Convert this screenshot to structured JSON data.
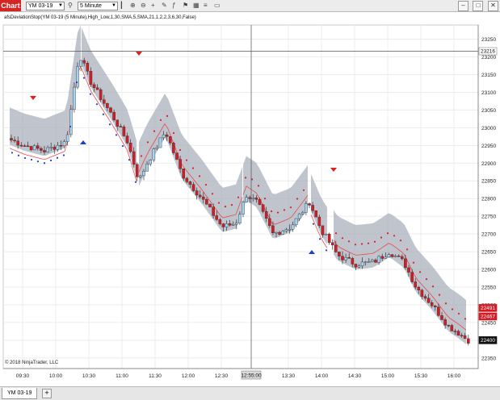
{
  "toolbar": {
    "tab_label": "Chart",
    "instrument": "YM 03-19",
    "interval": "5 Minute",
    "icons": [
      "search-icon",
      "bar-style-icon",
      "zoom-in-icon",
      "zoom-out-icon",
      "crosshair-icon",
      "draw-icon",
      "indicators-icon",
      "strategies-icon",
      "data-box-icon",
      "properties-icon",
      "template-icon"
    ],
    "window_buttons": [
      "minimize-icon",
      "maximize-icon",
      "close-icon"
    ]
  },
  "indicator_label": "afsDeviationStop(YM 03-19 (5 Minute),High_Low,1,30,SMA,5,SMA,21,1,2,2,3,6,30,False)",
  "copyright": "© 2018 NinjaTrader, LLC",
  "bottom_tab": "YM 03-19",
  "add_tab_label": "+",
  "colors": {
    "up_candle": "#a6d3f0",
    "down_candle": "#d51b23",
    "band": "#a9b0bc",
    "stop_line": "#e74c4c",
    "dot_red": "#e11d1d",
    "dot_blue": "#1a3fd1",
    "arrow_red": "#e11d1d",
    "arrow_blue": "#1a3fd1"
  },
  "chart_data": {
    "type": "candlestick",
    "y_range": [
      22320,
      23290
    ],
    "y_ticks": [
      22350,
      22400,
      22450,
      22500,
      22550,
      22600,
      22650,
      22700,
      22750,
      22800,
      22850,
      22900,
      22950,
      23000,
      23050,
      23100,
      23150,
      23200,
      23250
    ],
    "x_ticks": [
      "09:30",
      "10:00",
      "10:30",
      "11:00",
      "11:30",
      "12:00",
      "12:30",
      "12:55:00",
      "13:30",
      "14:00",
      "14:30",
      "15:00",
      "15:30",
      "16:00"
    ],
    "price_labels": [
      {
        "value": "23216",
        "style": "plain"
      },
      {
        "value": "22491",
        "style": "red"
      },
      {
        "value": "22467",
        "style": "red"
      },
      {
        "value": "22400",
        "style": "black"
      }
    ],
    "crosshair": {
      "x_label": "12:55:00",
      "y_label": "23216"
    },
    "grid": true
  }
}
